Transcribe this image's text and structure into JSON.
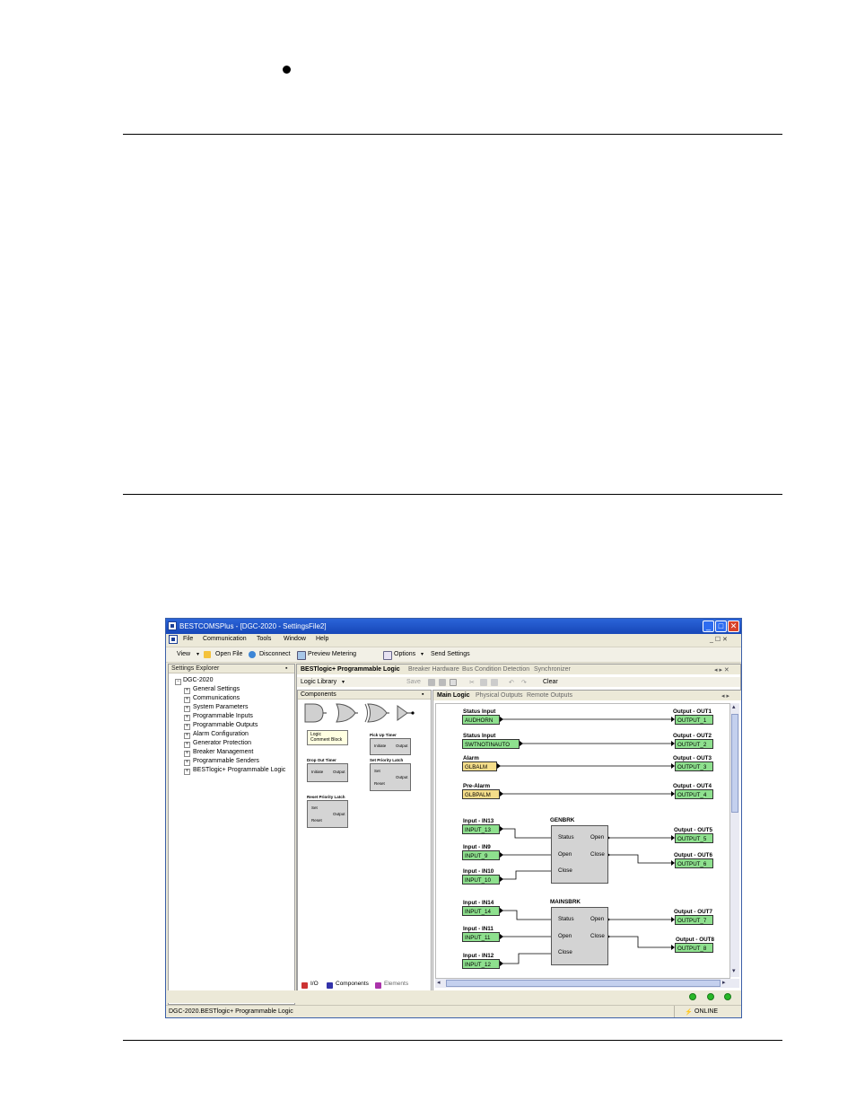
{
  "window": {
    "title": "BESTCOMSPlus - [DGC-2020 - SettingsFile2]",
    "min": "_",
    "max": "□",
    "close": "✕"
  },
  "menu": [
    "File",
    "Communication",
    "Tools",
    "Window",
    "Help"
  ],
  "menu_right": "_ ☐ ✕",
  "toolbar": {
    "view": "View",
    "open_file": "Open File",
    "disconnect": "Disconnect",
    "preview_metering": "Preview Metering",
    "options": "Options",
    "send_settings": "Send Settings"
  },
  "explorer": {
    "title": "Settings Explorer",
    "root": "DGC-2020",
    "items": [
      "General Settings",
      "Communications",
      "System Parameters",
      "Programmable Inputs",
      "Programmable Outputs",
      "Alarm Configuration",
      "Generator Protection",
      "Breaker Management",
      "Programmable Senders",
      "BESTlogic+ Programmable Logic"
    ]
  },
  "doc_tabs": [
    "BESTlogic+ Programmable Logic",
    "Breaker Hardware",
    "Bus Condition Detection",
    "Synchronizer"
  ],
  "logic_toolbar": {
    "library": "Logic Library",
    "save": "Save",
    "clear": "Clear"
  },
  "components": {
    "title": "Components",
    "tooltip_line1": "Logic",
    "tooltip_line2": "Comment Block",
    "pickup_timer": {
      "title": "Pick Up Timer",
      "initiate": "Initiate",
      "output": "Output"
    },
    "dropout_timer": {
      "title": "Drop Out Timer",
      "initiate": "Initiate",
      "output": "Output"
    },
    "set_latch": {
      "title": "Set Priority Latch",
      "set": "Set",
      "reset": "Reset",
      "output": "Output"
    },
    "reset_latch": {
      "title": "Reset Priority Latch",
      "set": "Set",
      "reset": "Reset",
      "output": "Output"
    },
    "bottom_tabs": [
      "I/O",
      "Components",
      "Elements"
    ]
  },
  "canvas_tabs": [
    "Main Logic",
    "Physical Outputs",
    "Remote Outputs"
  ],
  "logic": {
    "rows": [
      {
        "in_label": "Status Input",
        "in_pin": "AUDHORN",
        "in_color": "green",
        "out_label": "Output - OUT1",
        "out_pin": "OUTPUT_1"
      },
      {
        "in_label": "Status Input",
        "in_pin": "SWTNOTINAUTO",
        "in_color": "green",
        "out_label": "Output - OUT2",
        "out_pin": "OUTPUT_2"
      },
      {
        "in_label": "Alarm",
        "in_pin": "GLBALM",
        "in_color": "yellow",
        "out_label": "Output - OUT3",
        "out_pin": "OUTPUT_3"
      },
      {
        "in_label": "Pre-Alarm",
        "in_pin": "GLBPALM",
        "in_color": "yellow",
        "out_label": "Output - OUT4",
        "out_pin": "OUTPUT_4"
      }
    ],
    "genbrk": {
      "title": "GENBRK",
      "ports": [
        "Status",
        "Open",
        "Close"
      ],
      "out_ports": [
        "Open",
        "Close"
      ],
      "inputs": [
        {
          "label": "Input - IN13",
          "pin": "INPUT_13"
        },
        {
          "label": "Input - IN9",
          "pin": "INPUT_9"
        },
        {
          "label": "Input - IN10",
          "pin": "INPUT_10"
        }
      ],
      "outputs": [
        {
          "label": "Output - OUT5",
          "pin": "OUTPUT_5"
        },
        {
          "label": "Output - OUT6",
          "pin": "OUTPUT_6"
        }
      ]
    },
    "mainsbrk": {
      "title": "MAINSBRK",
      "ports": [
        "Status",
        "Open",
        "Close"
      ],
      "out_ports": [
        "Open",
        "Close"
      ],
      "inputs": [
        {
          "label": "Input - IN14",
          "pin": "INPUT_14"
        },
        {
          "label": "Input - IN11",
          "pin": "INPUT_11"
        },
        {
          "label": "Input - IN12",
          "pin": "INPUT_12"
        }
      ],
      "outputs": [
        {
          "label": "Output - OUT7",
          "pin": "OUTPUT_7"
        },
        {
          "label": "Output - OUT8",
          "pin": "OUTPUT_8"
        }
      ]
    }
  },
  "status": {
    "path": "DGC-2020.BESTlogic+ Programmable Logic",
    "online": "ONLINE"
  }
}
